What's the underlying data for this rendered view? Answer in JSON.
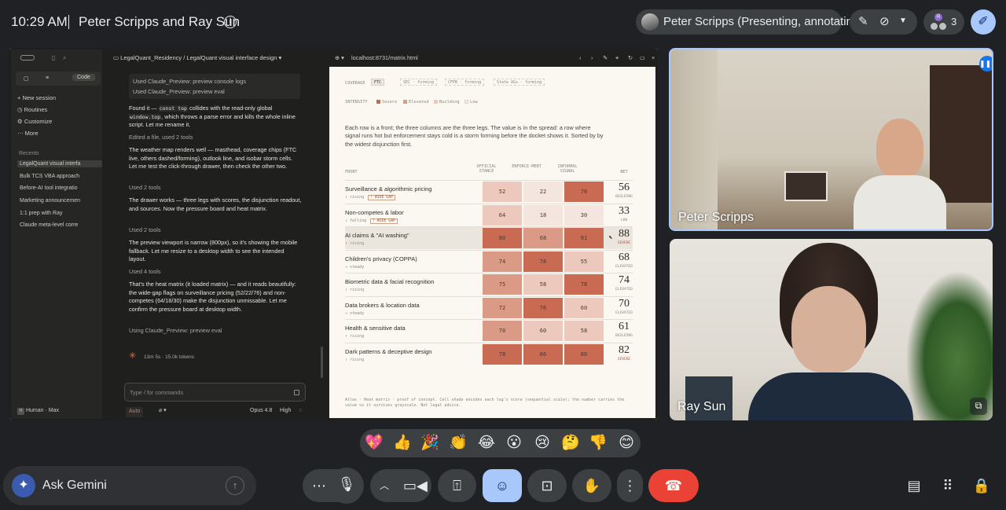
{
  "topbar": {
    "time": "10:29 AM",
    "meeting_title": "Peter Scripps and Ray Sun",
    "info_icon": "info-icon",
    "presenter_chip": "Peter Scripps (Presenting, annotating)",
    "people_count": "3",
    "people_badge": "R"
  },
  "screen": {
    "left_rail": {
      "tabs": [
        "Code"
      ],
      "nav": [
        "New session",
        "Routines",
        "Customize",
        "More"
      ],
      "recents_label": "Recents",
      "recents": [
        "LegalQuant visual interfa",
        "Bulk TCS VBA approach",
        "Before-AI tool integratio",
        "Marketing announcemen",
        "1:1 prep with Ray",
        "Claude meta-level corre"
      ],
      "footer_user": "Human",
      "footer_plan": "Max"
    },
    "chat": {
      "header": "LegalQuant_Residency / LegalQuant visual interface design",
      "tool_box": [
        "Used Claude_Preview: preview console logs",
        "Used Claude_Preview: preview eval"
      ],
      "msg1_a": "Found it —",
      "msg1_code1": "const top",
      "msg1_b": "collides with the read-only global",
      "msg1_code2": "window.top",
      "msg1_c": ", which throws a parse error and kills the whole inline script. Let me rename it.",
      "tool1": "Edited a file, used 2 tools",
      "msg2": "The weather map renders well — masthead, coverage chips (FTC live, others dashed/forming), outlook line, and isobar storm cells. Let me test the click-through drawer, then check the other two.",
      "tool2": "Used 2 tools",
      "msg3": "The drawer works — three legs with scores, the disjunction readout, and sources. Now the pressure board and heat matrix.",
      "tool3": "Used 2 tools",
      "msg4": "The preview viewport is narrow (800px), so it's showing the mobile fallback. Let me resize to a desktop width to see the intended layout.",
      "tool4": "Used 4 tools",
      "msg5": "That's the heat matrix (it loaded matrix) — and it reads beautifully: the wide-gap flags on surveillance pricing (52/22/76) and non-competes (64/18/30) make the disjunction unmissable. Let me confirm the pressure board at desktop width.",
      "tool5": "Using Claude_Preview: preview eval",
      "timer": "13m 5s · 15.0k tokens",
      "input_placeholder": "Type / for commands",
      "footer_mode": "Auto",
      "footer_model": "Opus 4.8",
      "footer_effort": "High"
    },
    "browser": {
      "url": "localhost:8731/matrix.html",
      "coverage_label": "COVERAGE",
      "coverage_chips": [
        "FTC",
        "SEC · forming",
        "CFPB · forming",
        "State AGs · forming"
      ],
      "intensity_label": "INTENSITY",
      "legend": [
        "Severe",
        "Elevated",
        "Building",
        "Low"
      ],
      "legend_colors": [
        "#c96a52",
        "#db9a86",
        "#ecc9bc",
        "#f4e6de"
      ],
      "intro": "Each row is a front; the three columns are the three legs. The value is in the spread: a row where signal runs hot but enforcement stays cold is a storm forming before the docket shows it. Sorted by by the widest disjunction first.",
      "columns": [
        "FRONT",
        "OFFICIAL STANCE",
        "ENFORCE-MENT",
        "INFORMAL SIGNAL",
        "NET"
      ],
      "rows": [
        {
          "name": "Surveillance & algorithmic pricing",
          "trend": "↑ rising",
          "flag": "! WIDE GAP",
          "values": [
            52,
            22,
            76
          ],
          "net": 56,
          "level": "BUILDING"
        },
        {
          "name": "Non-competes & labor",
          "trend": "↓ falling",
          "flag": "! WIDE GAP",
          "values": [
            64,
            18,
            30
          ],
          "net": 33,
          "level": "LOW"
        },
        {
          "name": "AI claims & \"AI washing\"",
          "trend": "↑ rising",
          "flag": "",
          "values": [
            80,
            68,
            91
          ],
          "net": 88,
          "level": "SEVERE"
        },
        {
          "name": "Children's privacy (COPPA)",
          "trend": "→ steady",
          "flag": "",
          "values": [
            74,
            78,
            55
          ],
          "net": 68,
          "level": "ELEVATED"
        },
        {
          "name": "Biometric data & facial recognition",
          "trend": "↑ rising",
          "flag": "",
          "values": [
            75,
            58,
            78
          ],
          "net": 74,
          "level": "ELEVATED"
        },
        {
          "name": "Data brokers & location data",
          "trend": "→ steady",
          "flag": "",
          "values": [
            72,
            76,
            60
          ],
          "net": 70,
          "level": "ELEVATED"
        },
        {
          "name": "Health & sensitive data",
          "trend": "↑ rising",
          "flag": "",
          "values": [
            70,
            60,
            58
          ],
          "net": 61,
          "level": "BUILDING"
        },
        {
          "name": "Dark patterns & deceptive design",
          "trend": "↑ rising",
          "flag": "",
          "values": [
            78,
            86,
            80
          ],
          "net": 82,
          "level": "SEVERE"
        }
      ],
      "footnote": "Atlas · Heat matrix · proof of concept. Cell shade encodes each leg's score (sequential scale); the number carries the value so it survives grayscale. Not legal advice."
    }
  },
  "tiles": {
    "peter": "Peter Scripps",
    "ray": "Ray Sun"
  },
  "emoji_reactions": [
    "💖",
    "👍",
    "🎉",
    "👏",
    "😂",
    "😮",
    "😢",
    "🤔",
    "👎",
    "😊"
  ],
  "gemini": {
    "label": "Ask Gemini"
  },
  "colors": {
    "accent_blue": "#a8c7fa",
    "end_call_red": "#ea4335",
    "cell_scale": [
      "#f4e6de",
      "#ecc9bc",
      "#db9a86",
      "#c96a52"
    ]
  }
}
